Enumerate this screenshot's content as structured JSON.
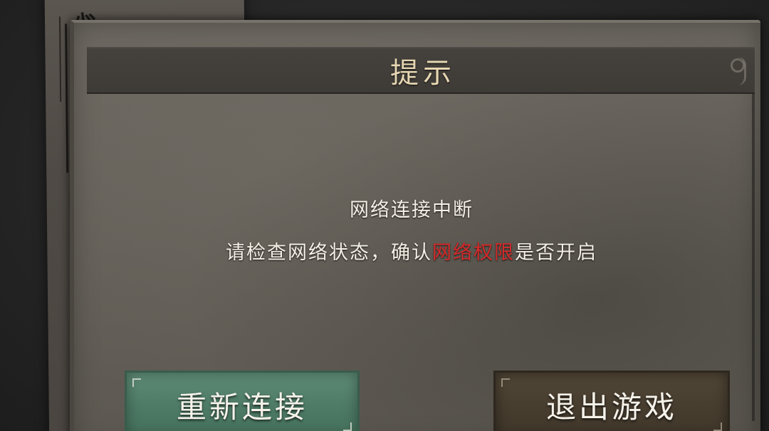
{
  "dialog": {
    "title": "提示",
    "message": {
      "line1": "网络连接中断",
      "line2_prefix": "请检查网络状态，确认",
      "line2_highlight": "网络权限",
      "line2_suffix": "是否开启"
    }
  },
  "buttons": {
    "reconnect_label": "重新连接",
    "exit_label": "退出游戏"
  },
  "colors": {
    "highlight": "#d42a2a",
    "reconnect_button": "#4d7a65",
    "exit_button": "#473d2f",
    "title_text": "#e6d6b2"
  },
  "icons": {
    "corner_ornament": "scroll-ornament-icon"
  }
}
